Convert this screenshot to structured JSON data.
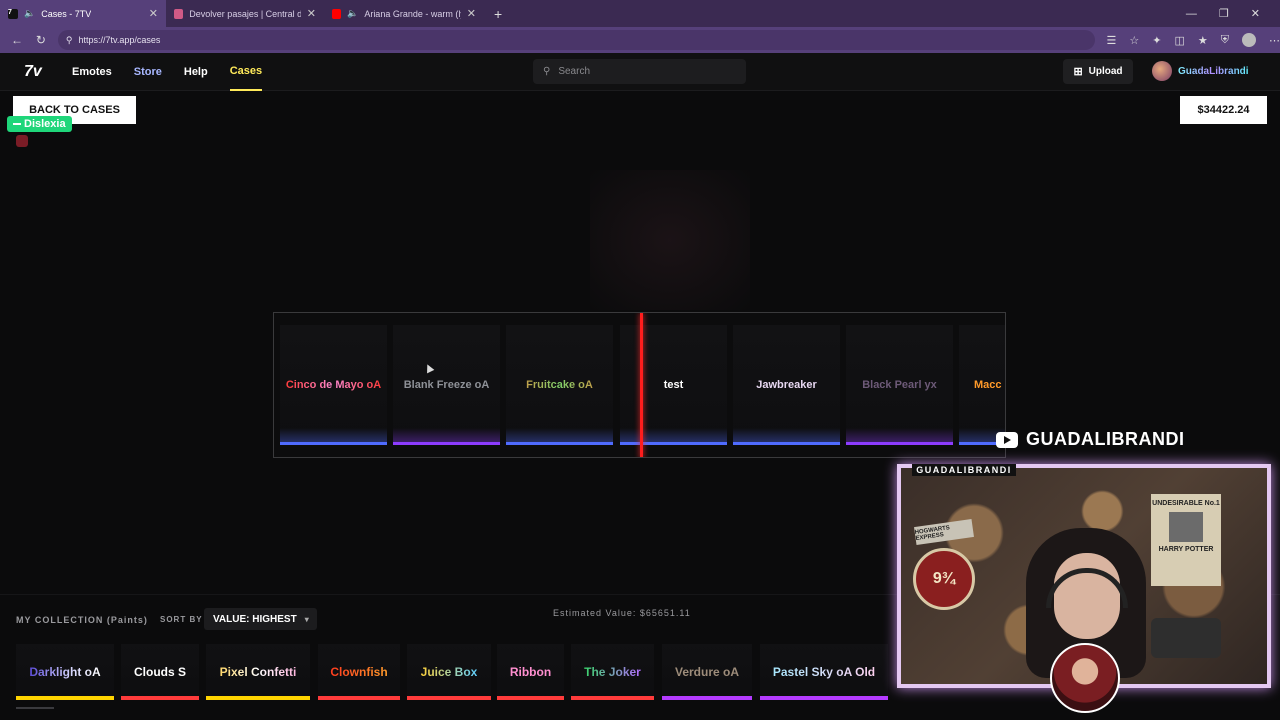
{
  "browser": {
    "tabs": [
      {
        "title": "Cases - 7TV",
        "active": true,
        "color": "#ffffff"
      },
      {
        "title": "Devolver pasajes | Central de Pasa",
        "active": false,
        "color": "#d05a86"
      },
      {
        "title": "Ariana Grande - warm (lyric v",
        "active": false,
        "color": "#ff0000"
      }
    ],
    "url": "https://7tv.app/cases"
  },
  "header": {
    "logo": "7v",
    "nav": [
      "Emotes",
      "Store",
      "Help",
      "Cases"
    ],
    "search_placeholder": "Search",
    "upload_label": "Upload",
    "username": "GuadaLibrandi"
  },
  "main": {
    "back_label": "BACK TO CASES",
    "balance": "$34422.24",
    "badge": "Dislexia"
  },
  "reel": {
    "items": [
      {
        "label": "Cinco de Mayo oA",
        "bar_color": "#4f6bff"
      },
      {
        "label": "Blank Freeze oA",
        "bar_color": "#8d3bff"
      },
      {
        "label": "Fruitcake oA",
        "bar_color": "#4f6bff"
      },
      {
        "label": "test",
        "bar_color": "#4f6bff"
      },
      {
        "label": "Jawbreaker",
        "bar_color": "#4f6bff"
      },
      {
        "label": "Black Pearl yx",
        "bar_color": "#8d3bff"
      },
      {
        "label": "Macc",
        "bar_color": "#4f6bff"
      }
    ]
  },
  "collection": {
    "title": "MY COLLECTION (Paints)",
    "sort_by_label": "SORT BY",
    "sort_value": "VALUE: HIGHEST",
    "estimated_value": "Estimated Value: $65651.11",
    "paints": [
      {
        "label": "Darklight oA",
        "bar_color": "#ffd400"
      },
      {
        "label": "Clouds S",
        "bar_color": "#ff3b3b"
      },
      {
        "label": "Pixel Confetti",
        "bar_color": "#ffd400"
      },
      {
        "label": "Clownfish",
        "bar_color": "#ff3b3b"
      },
      {
        "label": "Juice Box",
        "bar_color": "#ff3b3b"
      },
      {
        "label": "Ribbon",
        "bar_color": "#ff3b3b"
      },
      {
        "label": "The Joker",
        "bar_color": "#ff3b3b"
      },
      {
        "label": "Verdure oA",
        "bar_color": "#b43bff"
      },
      {
        "label": "Pastel Sky oA Old",
        "bar_color": "#b43bff"
      }
    ]
  },
  "stream": {
    "channel": "GUADALIBRANDI",
    "cam_label": "GUADALIBRANDI",
    "sign_text": "HOGWARTS EXPRESS",
    "platform_text": "9¾",
    "poster_title": "UNDESIRABLE No.1",
    "poster_name": "HARRY POTTER"
  }
}
